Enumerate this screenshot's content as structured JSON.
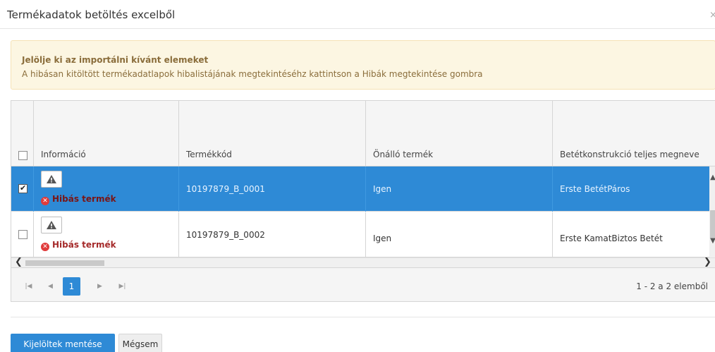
{
  "dialog": {
    "title": "Termékadatok betöltés excelből",
    "close": "×"
  },
  "alert": {
    "title": "Jelölje ki az importálni kívánt elemeket",
    "text": "A hibásan kitöltött termékadatlapok hibalistájának megtekintéséhz kattintson a Hibák megtekintése gombra"
  },
  "grid": {
    "columns": [
      "Információ",
      "Termékkód",
      "Önálló termék",
      "Betétkonstrukció teljes megneve"
    ],
    "rows": [
      {
        "checked": true,
        "status": "Hibás termék",
        "code": "10197879_B_0001",
        "standalone": "Igen",
        "name": "Erste BetétPáros"
      },
      {
        "checked": false,
        "status": "Hibás termék",
        "code": "10197879_B_0002",
        "standalone": "Igen",
        "name": "Erste KamatBiztos Betét"
      }
    ]
  },
  "pager": {
    "current_page": "1",
    "info": "1 - 2 a 2 elemből"
  },
  "buttons": {
    "save": "Kijelöltek mentése",
    "cancel": "Mégsem"
  }
}
